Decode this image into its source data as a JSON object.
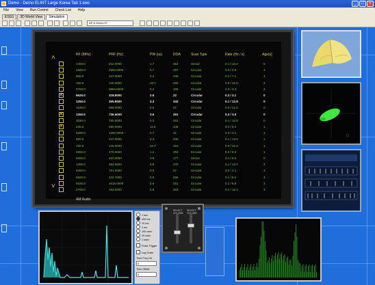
{
  "window": {
    "title": "Demo - Demo ELINT Large Korea Tab 1.ews"
  },
  "menu": [
    "File",
    "View",
    "Run Control",
    "Check List",
    "Help"
  ],
  "tabs": [
    {
      "label": "ESG1",
      "active": false
    },
    {
      "label": "3D World View",
      "active": false
    },
    {
      "label": "Simulation",
      "active": true
    }
  ],
  "toolbar": {
    "combo_value": "AP-6 Series 07"
  },
  "table": {
    "columns": [
      "RF (MHz)",
      "PRF (Hz)",
      "PW (us)",
      "DOA",
      "Scan Type",
      "Rate (Hz / s)",
      "Age(s)"
    ],
    "rows": [
      {
        "rf": "1450.0",
        "prf": "212.0000",
        "pw": "1.7",
        "doa": "254",
        "scan": "Sector",
        "rate": "0.1  /  10.2",
        "age": "5",
        "checked": false,
        "hl": false
      },
      {
        "rf": "2800.0",
        "prf": "2550.0000",
        "pw": "0.7",
        "doa": "297",
        "scan": "Circular",
        "rate": "0.3  /  4.9",
        "age": "4",
        "checked": false,
        "hl": false
      },
      {
        "rf": "850.0",
        "prf": "347.0000",
        "pw": "2.4",
        "doa": "346",
        "scan": "Circular",
        "rate": "0.1  /  7.1",
        "age": "4",
        "checked": false,
        "hl": false
      },
      {
        "rf": "150.0",
        "prf": "145.0000",
        "pw": "10.7",
        "doa": "265",
        "scan": "Circular",
        "rate": "0.0  /  31.0",
        "age": "3",
        "checked": false,
        "hl": false
      },
      {
        "rf": "9700.0",
        "prf": "3892.0000",
        "pw": "0.2",
        "doa": "158",
        "scan": "Circular",
        "rate": "0.3  /  3.4",
        "age": "3",
        "checked": false,
        "hl": false
      },
      {
        "rf": "5625.0",
        "prf": "318.8000",
        "pw": "2.6",
        "doa": "22",
        "scan": "Circular",
        "rate": "0.3  /  3.1",
        "age": "0",
        "checked": true,
        "hl": true
      },
      {
        "rf": "1250.0",
        "prf": "355.8000",
        "pw": "3.3",
        "doa": "342",
        "scan": "Circular",
        "rate": "0.1  /  12.8",
        "age": "0",
        "checked": false,
        "hl": true
      },
      {
        "rf": "1530.0",
        "prf": "395.0000",
        "pw": "0.9",
        "doa": "57",
        "scan": "Circular",
        "rate": "0.0  /  21.0",
        "age": "0",
        "checked": false,
        "hl": false
      },
      {
        "rf": "1250.0",
        "prf": "735.5000",
        "pw": "3.6",
        "doa": "251",
        "scan": "Circular",
        "rate": "0.3  /  3.0",
        "age": "0",
        "checked": true,
        "hl": true
      },
      {
        "rf": "3030.0",
        "prf": "765.5000",
        "pw": "0.2",
        "doa": "291",
        "scan": "Circular",
        "rate": "0.1  /  12.8",
        "age": "0",
        "checked": false,
        "hl": false
      },
      {
        "rf": "235.0",
        "prf": "350.0000",
        "pw": "11.6",
        "doa": "346",
        "scan": "Circular",
        "rate": "0.2  /  6.2",
        "age": "1",
        "checked": true,
        "hl": false
      },
      {
        "rf": "9290.0",
        "prf": "1250.0000",
        "pw": "0.7",
        "doa": "41",
        "scan": "Circular",
        "rate": "0.3  /  3.1",
        "age": "1",
        "checked": false,
        "hl": false
      },
      {
        "rf": "850.0",
        "prf": "247.0000",
        "pw": "2.4",
        "doa": "206",
        "scan": "Circular",
        "rate": "0.1  /  12.8",
        "age": "1",
        "checked": false,
        "hl": false
      },
      {
        "rf": "150.0",
        "prf": "146.0000",
        "pw": "10.7",
        "doa": "315",
        "scan": "Circular",
        "rate": "0.0  /  31.0",
        "age": "1",
        "checked": false,
        "hl": false
      },
      {
        "rf": "3900.0",
        "prf": "470.0000",
        "pw": "1.2",
        "doa": "253",
        "scan": "Circular",
        "rate": "0.2  /  5.0",
        "age": "1",
        "checked": false,
        "hl": false
      },
      {
        "rf": "9300.0",
        "prf": "420.0000",
        "pw": "3.8",
        "doa": "277",
        "scan": "Sector",
        "rate": "0.1  /  8.2",
        "age": "0",
        "checked": false,
        "hl": false
      },
      {
        "rf": "1300.0",
        "prf": "382.5000",
        "pw": "6.8",
        "doa": "275",
        "scan": "Circular",
        "rate": "0.1  /  12.7",
        "age": "4",
        "checked": false,
        "hl": false
      },
      {
        "rf": "9450.0",
        "prf": "751.0000",
        "pw": "0.6",
        "doa": "57",
        "scan": "Circular",
        "rate": "0.2  /  4.1",
        "age": "4",
        "checked": false,
        "hl": false
      },
      {
        "rf": "2820.0",
        "prf": "442.7000",
        "pw": "0.9",
        "doa": "256",
        "scan": "Circular",
        "rate": "0.1  /  8.2",
        "age": "4",
        "checked": false,
        "hl": false
      },
      {
        "rf": "9100.0",
        "prf": "1615.0000",
        "pw": "0.6",
        "doa": "251",
        "scan": "Circular",
        "rate": "0.1  /  8.9",
        "age": "3",
        "checked": false,
        "hl": false
      },
      {
        "rf": "2700.0",
        "prf": "153.0000",
        "pw": "4.9",
        "doa": "303",
        "scan": "Circular",
        "rate": "0.1  /  12.3",
        "age": "3",
        "checked": false,
        "hl": false
      }
    ],
    "footer_label": "AM Audio"
  },
  "options_panel": {
    "radio_items": [
      {
        "label": "1 sec",
        "selected": false
      },
      {
        "label": "100 ms",
        "selected": true
      },
      {
        "label": "10 ms",
        "selected": false
      },
      {
        "label": "1 ms",
        "selected": false
      },
      {
        "label": "100 usec",
        "selected": false
      },
      {
        "label": "10 usec",
        "selected": false
      },
      {
        "label": "1 usec",
        "selected": false
      }
    ],
    "checkbox_pulse": "Pulse Trigger",
    "checkbox_log": "Log Scale",
    "field1_label": "Time Freq Hlt",
    "field1_value": "0",
    "field2_label": "Time Offset",
    "field2_value": "0"
  },
  "mixer": {
    "channels": [
      {
        "label": "SELECT VOLUME",
        "level": 0.35
      },
      {
        "label": "SELECT VOLUME",
        "level": 0.6
      }
    ]
  },
  "colors": {
    "workspace": "#1f6edc",
    "table_text": "#7ec24a",
    "table_header": "#e6d24a",
    "waveform_cyan": "#3ee8e8",
    "spectrum_green": "#2fd12f"
  }
}
